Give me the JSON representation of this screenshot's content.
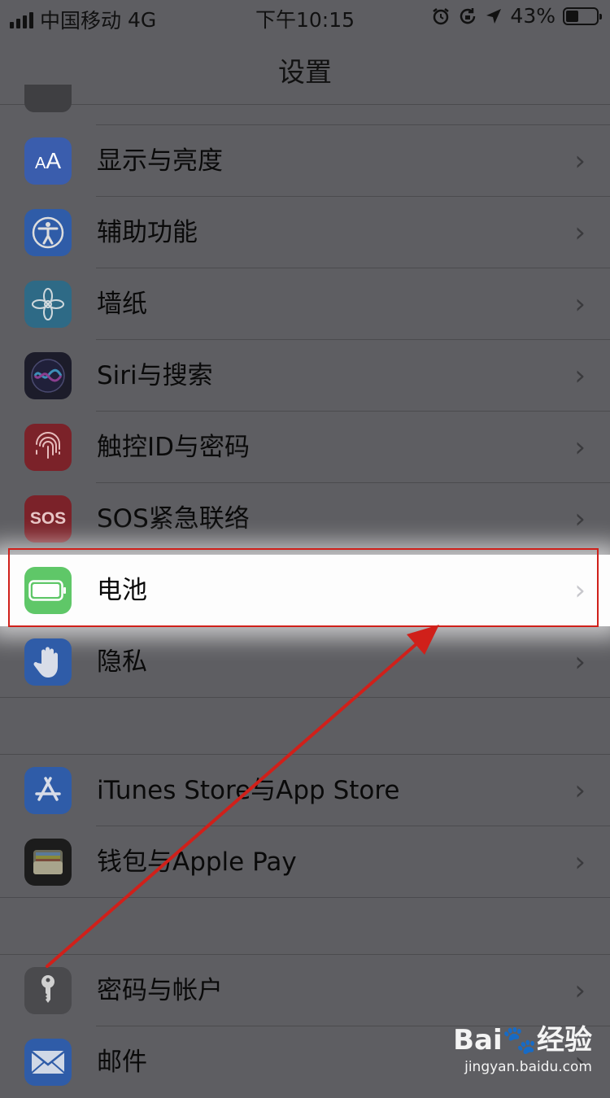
{
  "status_bar": {
    "carrier": "中国移动",
    "network": "4G",
    "time": "下午10:15",
    "battery_percent": "43%",
    "battery_level": 0.43
  },
  "nav": {
    "title": "设置"
  },
  "settings_items": [
    {
      "label": "显示与亮度",
      "icon": "display-brightness-icon",
      "color": "#3a5dad"
    },
    {
      "label": "辅助功能",
      "icon": "accessibility-icon",
      "color": "#2f5ca8"
    },
    {
      "label": "墙纸",
      "icon": "wallpaper-icon",
      "color": "#2e6a86"
    },
    {
      "label": "Siri与搜索",
      "icon": "siri-icon",
      "color": "#1c1c2a"
    },
    {
      "label": "触控ID与密码",
      "icon": "fingerprint-icon",
      "color": "#7b2229"
    },
    {
      "label": "SOS紧急联络",
      "icon": "sos-icon",
      "color": "#7b2229"
    },
    {
      "label": "电池",
      "icon": "battery-icon",
      "color": "#5fc768",
      "highlighted": true
    },
    {
      "label": "隐私",
      "icon": "privacy-hand-icon",
      "color": "#2f5ca8"
    }
  ],
  "store_items": [
    {
      "label": "iTunes Store与App Store",
      "icon": "app-store-icon",
      "color": "#2f5ca8"
    },
    {
      "label": "钱包与Apple Pay",
      "icon": "wallet-icon",
      "color": "#1c1c1c"
    }
  ],
  "account_items": [
    {
      "label": "密码与帐户",
      "icon": "key-icon",
      "color": "#4a4a4d"
    },
    {
      "label": "邮件",
      "icon": "mail-icon",
      "color": "#2f5ca8"
    }
  ],
  "annotation_color": "#d0201a",
  "watermark": {
    "brand": "Bai",
    "brand_suffix": "经验",
    "url": "jingyan.baidu.com"
  }
}
